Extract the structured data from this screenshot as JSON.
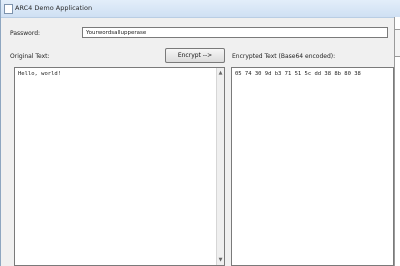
{
  "window": {
    "title": "ARC4 Demo Application"
  },
  "password": {
    "label": "Password:",
    "value": "Yourwordsallupperase"
  },
  "original": {
    "label": "Original Text:",
    "text": "Hello, world!"
  },
  "encrypt_button": {
    "label": "Encrypt -->"
  },
  "encrypted": {
    "label": "Encrypted Text (Base64 encoded):",
    "text": "05 74 30 9d b3 71 51 5c dd 38 8b 80 38"
  },
  "icons": {
    "scroll_up": "up-arrow-icon",
    "scroll_down": "down-arrow-icon",
    "app": "app-icon"
  }
}
